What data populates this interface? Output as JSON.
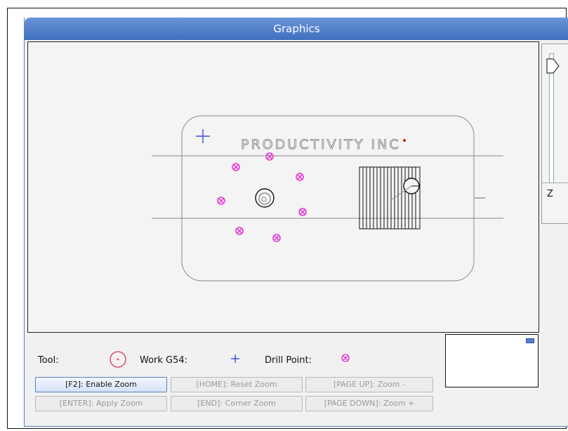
{
  "window": {
    "title": "Graphics"
  },
  "viewport": {
    "part_label": "PRODUCTIVITY INC"
  },
  "z_axis": {
    "label": "Z"
  },
  "legend": {
    "tool_label": "Tool:",
    "work_label": "Work G54:",
    "drill_label": "Drill Point:",
    "tool_color": "#e0334d",
    "work_color": "#2233cc",
    "drill_color": "#e64ad6"
  },
  "buttons": {
    "enable_zoom": "[F2]: Enable Zoom",
    "reset_zoom": "[HOME]: Reset Zoom",
    "zoom_out": "[PAGE UP]: Zoom -",
    "apply_zoom": "[ENTER]: Apply Zoom",
    "corner_zoom": "[END]: Corner Zoom",
    "zoom_in": "[PAGE DOWN]: Zoom +"
  }
}
